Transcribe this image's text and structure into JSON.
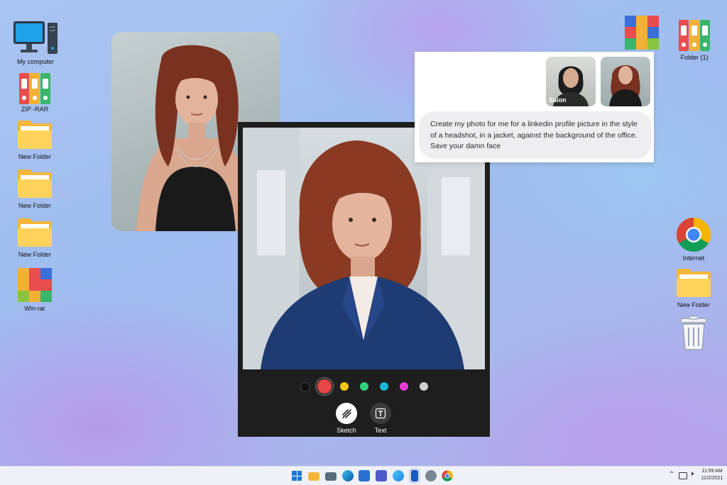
{
  "desktop": {
    "left_icons": [
      {
        "label": "My computer",
        "icon": "computer-icon"
      },
      {
        "label": "ZIP -RAR",
        "icon": "binders-icon"
      },
      {
        "label": "New Folder",
        "icon": "folder-icon"
      },
      {
        "label": "New Folder",
        "icon": "folder-icon"
      },
      {
        "label": "New Folder",
        "icon": "folder-icon"
      },
      {
        "label": "Win-rar",
        "icon": "winrar-icon"
      }
    ],
    "right_icons": [
      {
        "label": "",
        "icon": "winrar-icon"
      },
      {
        "label": "Folder (1)",
        "icon": "binders-icon"
      },
      {
        "label": "Internet",
        "icon": "chrome-icon"
      },
      {
        "label": "New Folder",
        "icon": "folder-icon"
      },
      {
        "label": "",
        "icon": "recycle-bin-icon"
      }
    ]
  },
  "chat": {
    "thumbnails": [
      {
        "label": "Salon"
      },
      {
        "label": ""
      }
    ],
    "message": "Create my photo for me for a linkedin profile picture in the style of a headshot, in a jacket, against the background of the office. Save your damn face"
  },
  "editor": {
    "colors": [
      "#111111",
      "#e84545",
      "#f5c518",
      "#2fd07a",
      "#19b7d6",
      "#e83ed6",
      "#cfcfcf"
    ],
    "selected_color_index": 1,
    "tools": [
      {
        "label": "Sketch",
        "icon": "sketch-icon"
      },
      {
        "label": "Text",
        "icon": "text-icon"
      }
    ]
  },
  "taskbar": {
    "apps": [
      "windows-start-icon",
      "file-explorer-icon",
      "camera-icon",
      "edge-icon",
      "store-icon",
      "teams-icon",
      "photos-icon",
      "word-icon",
      "settings-icon",
      "chrome-icon"
    ],
    "time": "11:59 AM",
    "date": "11/2/2021"
  }
}
